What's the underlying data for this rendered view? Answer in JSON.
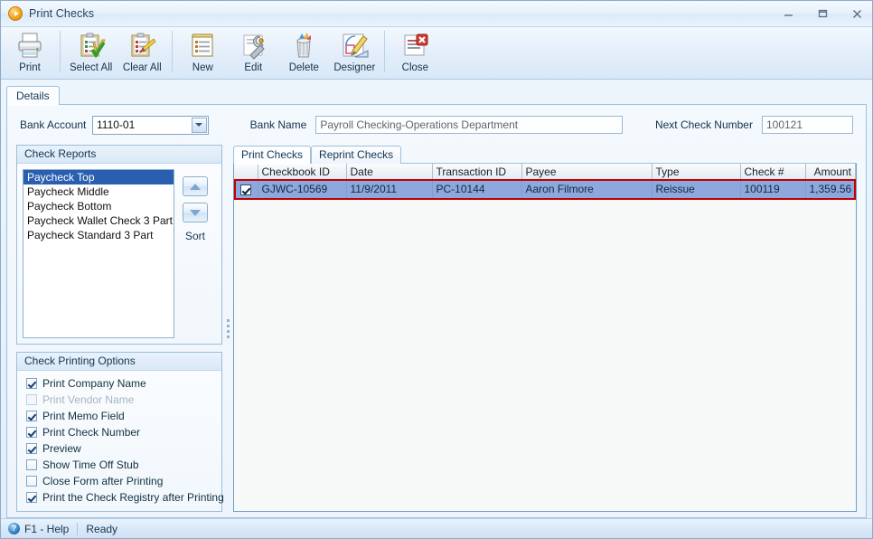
{
  "window": {
    "title": "Print Checks",
    "title_icon": "orange-play-circle-icon",
    "minimize_label": "minimize-icon",
    "maximize_label": "maximize-icon",
    "close_label": "close-icon"
  },
  "toolbar": {
    "items": [
      {
        "label": "Print",
        "icon": "printer-icon"
      },
      {
        "label": "Select All",
        "icon": "clipboard-check-icon"
      },
      {
        "label": "Clear All",
        "icon": "clipboard-eraser-icon"
      },
      {
        "label": "New",
        "icon": "new-document-icon"
      },
      {
        "label": "Edit",
        "icon": "wrench-icon"
      },
      {
        "label": "Delete",
        "icon": "trash-can-icon"
      },
      {
        "label": "Designer",
        "icon": "designer-ruler-pencil-icon"
      },
      {
        "label": "Close",
        "icon": "document-close-red-x-icon"
      }
    ]
  },
  "tabs": [
    {
      "label": "Details",
      "active": true
    }
  ],
  "fields": {
    "bank_account": {
      "label": "Bank Account",
      "value": "1110-01",
      "options": [
        "1110-01"
      ]
    },
    "bank_name": {
      "label": "Bank Name",
      "value": "Payroll Checking-Operations Department"
    },
    "next_check_number": {
      "label": "Next Check Number",
      "value": "100121"
    }
  },
  "check_reports": {
    "caption": "Check Reports",
    "items": [
      {
        "label": "Paycheck Top",
        "selected": true
      },
      {
        "label": "Paycheck Middle",
        "selected": false
      },
      {
        "label": "Paycheck Bottom",
        "selected": false
      },
      {
        "label": "Paycheck Wallet Check 3 Part",
        "selected": false
      },
      {
        "label": "Paycheck Standard 3 Part",
        "selected": false
      }
    ],
    "sort_label": "Sort",
    "move_up_icon": "triangle-up-icon",
    "move_down_icon": "triangle-down-icon"
  },
  "printing_options": {
    "caption": "Check Printing Options",
    "items": [
      {
        "label": "Print Company Name",
        "checked": true,
        "enabled": true
      },
      {
        "label": "Print Vendor Name",
        "checked": false,
        "enabled": false
      },
      {
        "label": "Print Memo Field",
        "checked": true,
        "enabled": true
      },
      {
        "label": "Print Check Number",
        "checked": true,
        "enabled": true
      },
      {
        "label": "Preview",
        "checked": true,
        "enabled": true
      },
      {
        "label": "Show Time Off Stub",
        "checked": false,
        "enabled": true
      },
      {
        "label": "Close Form after Printing",
        "checked": false,
        "enabled": true
      },
      {
        "label": "Print the Check Registry after Printing",
        "checked": true,
        "enabled": true
      }
    ]
  },
  "grid": {
    "tabs": [
      {
        "label": "Print Checks",
        "active": true
      },
      {
        "label": "Reprint Checks",
        "active": false
      }
    ],
    "columns": [
      {
        "label": "",
        "align": "center"
      },
      {
        "label": "Checkbook ID",
        "align": "left"
      },
      {
        "label": "Date",
        "align": "left"
      },
      {
        "label": "Transaction ID",
        "align": "left"
      },
      {
        "label": "Payee",
        "align": "left"
      },
      {
        "label": "Type",
        "align": "left"
      },
      {
        "label": "Check #",
        "align": "left"
      },
      {
        "label": "Amount",
        "align": "right"
      }
    ],
    "rows": [
      {
        "checked": true,
        "checkbook_id": "GJWC-10569",
        "date": "11/9/2011",
        "transaction_id": "PC-10144",
        "payee": "Aaron Filmore",
        "type": "Reissue",
        "check_number": "100119",
        "amount": "1,359.56",
        "highlighted": true
      }
    ]
  },
  "statusbar": {
    "help_icon": "question-mark-icon",
    "help_label": "F1 - Help",
    "status": "Ready"
  },
  "colors": {
    "title_text": "#24445e",
    "selection_blue": "#2a5fb0",
    "grid_row_blue": "#8ea8dd",
    "highlight_red": "#c00000",
    "frame_border": "#8aabc9"
  }
}
